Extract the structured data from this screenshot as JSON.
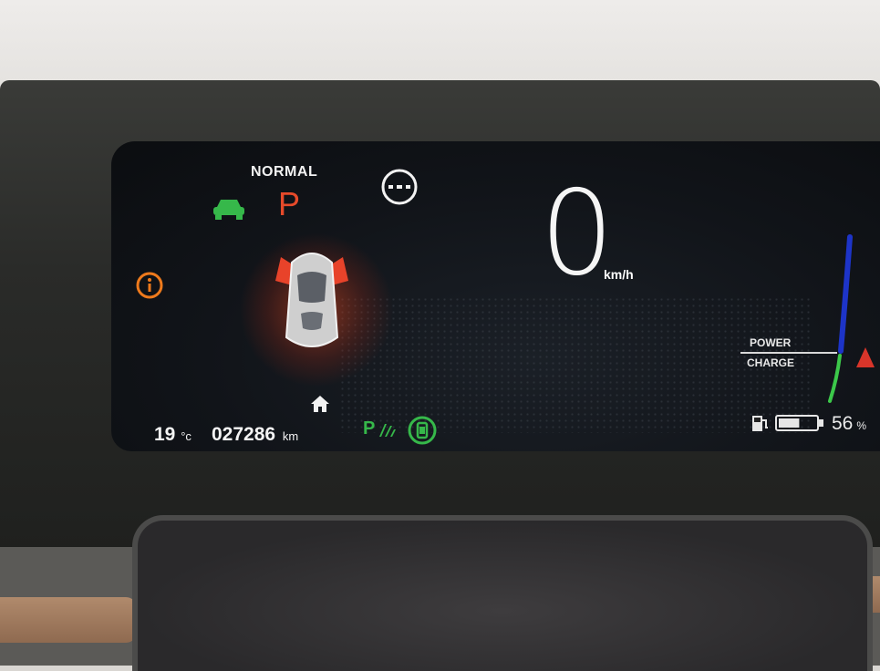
{
  "cluster": {
    "drive_mode": "NORMAL",
    "gear": "P",
    "speed": "0",
    "speed_unit": "km/h",
    "outside_temp": "19",
    "temp_unit": "°c",
    "odometer": "027286",
    "odometer_unit": "km",
    "power_label": "POWER",
    "charge_label": "CHARGE",
    "battery_percent": "56",
    "battery_percent_unit": "%",
    "park_assist_label": "P",
    "battery_level_fraction": 0.56
  },
  "colors": {
    "warning_orange": "#ee7a1c",
    "gear_red": "#e64a2a",
    "ready_green": "#36b84a",
    "power_blue": "#1d34c8",
    "charge_green": "#3cc84a"
  },
  "icons": {
    "ready": "car-ready-icon",
    "info": "info-warning-icon",
    "cruise": "cruise-off-icon",
    "doors": "doors-open-icon",
    "home": "home-icon",
    "park_assist": "park-assist-icon",
    "phone_key": "phone-key-icon",
    "fuel_charge": "charging-station-icon",
    "battery": "battery-icon",
    "warning_side": "warning-triangle-icon"
  }
}
